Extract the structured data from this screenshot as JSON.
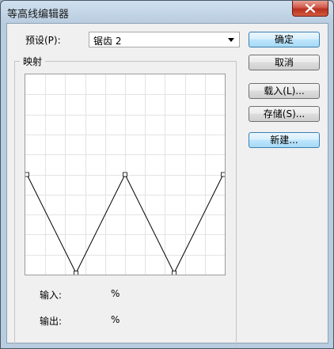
{
  "window": {
    "title": "等高线编辑器"
  },
  "preset": {
    "label": "预设(P):",
    "value": "锯齿 2"
  },
  "mapping": {
    "legend": "映射",
    "points": [
      {
        "input": 0,
        "output": 50
      },
      {
        "input": 25,
        "output": 0
      },
      {
        "input": 50,
        "output": 50
      },
      {
        "input": 75,
        "output": 0
      },
      {
        "input": 100,
        "output": 50
      }
    ]
  },
  "readout": {
    "input_label": "输入:",
    "input_unit": "%",
    "output_label": "输出:",
    "output_unit": "%"
  },
  "buttons": {
    "ok": "确定",
    "cancel": "取消",
    "load": "载入(L)...",
    "save": "存储(S)...",
    "new": "新建..."
  }
}
